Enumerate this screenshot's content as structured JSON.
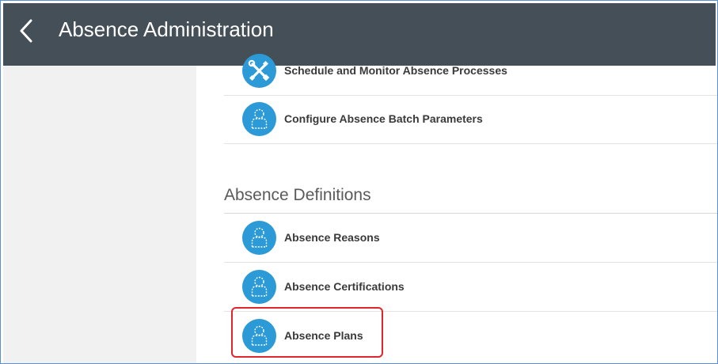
{
  "header": {
    "title": "Absence Administration",
    "back_icon": "chevron-left-icon",
    "background": "#454f57"
  },
  "tasks_top": [
    {
      "label": "Schedule and Monitor Absence Processes",
      "icon": "tools-icon"
    },
    {
      "label": "Configure Absence Batch Parameters",
      "icon": "person-outline-icon"
    }
  ],
  "section": {
    "title": "Absence Definitions"
  },
  "tasks_definitions": [
    {
      "label": "Absence Reasons",
      "icon": "person-outline-icon"
    },
    {
      "label": "Absence Certifications",
      "icon": "person-outline-icon"
    },
    {
      "label": "Absence Plans",
      "icon": "person-outline-icon",
      "highlighted": true
    }
  ],
  "colors": {
    "icon_circle": "#2b9ad6",
    "highlight": "#e0262c",
    "panel": "#f1f1f1"
  }
}
